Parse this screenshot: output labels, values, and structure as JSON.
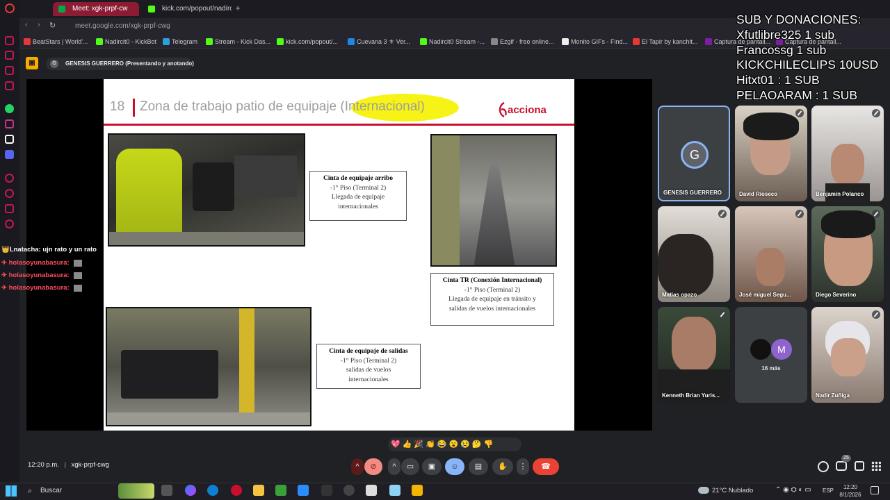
{
  "browser": {
    "tabs": [
      {
        "label": "Meet: xgk-prpf-cw",
        "active": true
      },
      {
        "label": "kick.com/popout/nadircl/c",
        "active": false
      }
    ],
    "url": "meet.google.com/xgk-prpf-cwg",
    "bookmarks": [
      {
        "label": "BeatStars | World'...",
        "color": "#e53935"
      },
      {
        "label": "Nadircit0 - KickBot",
        "color": "#53fc18"
      },
      {
        "label": "Telegram",
        "color": "#2aa1da"
      },
      {
        "label": "Stream - Kick Das...",
        "color": "#53fc18"
      },
      {
        "label": "kick.com/popout/...",
        "color": "#53fc18"
      },
      {
        "label": "Cuevana 3 ⚜ Ver...",
        "color": "#1e88e5"
      },
      {
        "label": "Nadircit0 Stream -...",
        "color": "#53fc18"
      },
      {
        "label": "Ezgif - free online...",
        "color": "#888888"
      },
      {
        "label": "Monito GIFs - Find...",
        "color": "#eeeeee"
      },
      {
        "label": "El Tapir by kanchit...",
        "color": "#e53935"
      },
      {
        "label": "Captura de pantall...",
        "color": "#7b1fa2"
      },
      {
        "label": "Captura de pantall...",
        "color": "#7b1fa2"
      }
    ]
  },
  "meet": {
    "presenter_label": "GENESIS GUERRERO (Presentando y anotando)",
    "presenter_initial": "G",
    "meeting_time": "12:20 p.m.",
    "meeting_code": "xgk-prpf-cwg",
    "reactions": [
      "💖",
      "👍",
      "🎉",
      "👏",
      "😂",
      "😮",
      "😢",
      "🤔",
      "👎"
    ],
    "participants_badge": "25",
    "participants": [
      {
        "name": "GENESIS GUERRERO",
        "initial": "G"
      },
      {
        "name": "David Rioseco"
      },
      {
        "name": "Benjamin Polanco"
      },
      {
        "name": "Matias opazo"
      },
      {
        "name": "José miguel Segu..."
      },
      {
        "name": "Diego Severino"
      },
      {
        "name": "Kenneth Brian Yuris..."
      },
      {
        "name": "16 más",
        "initial": "M"
      },
      {
        "name": "Nadir Zuñiga"
      }
    ]
  },
  "slide": {
    "number": "18",
    "title_main": "Zona de trabajo patio de equipaje ",
    "title_highlight": "(Internacional)",
    "logo": "acciona",
    "callouts": [
      {
        "title": "Cinta de equipaje arribo",
        "lines": [
          "-1° Piso (Terminal 2)",
          "Llegada de equipaje",
          "internacionales"
        ]
      },
      {
        "title": "Cinta TR (Conexión Internacional)",
        "lines": [
          "-1° Piso (Terminal 2)",
          "Llegada de equipaje en tránsito y",
          "salidas de vuelos internacionales"
        ]
      },
      {
        "title": "Cinta de equipaje de salidas",
        "lines": [
          "-1° Piso (Terminal 2)",
          "salidas de vuelos",
          "internacionales"
        ]
      }
    ]
  },
  "overlay": {
    "donations": [
      "SUB Y DONACIONES:",
      "Xfutlibre325 1 sub",
      "Francossg 1 sub",
      "KICKCHILECLIPS 10USD",
      "Hitxt01 : 1 SUB",
      "PELAOARAM : 1 SUB"
    ],
    "chat": [
      {
        "user": "👑Lnatacha:",
        "message": "ujn rato y un rato",
        "color": "#ffffff"
      },
      {
        "user": "✈ holasoyunabasura:",
        "message": "",
        "color": "#ff4d5e"
      },
      {
        "user": "✈ holasoyunabasura:",
        "message": "",
        "color": "#ff4d5e"
      },
      {
        "user": "✈ holasoyunabasura:",
        "message": "",
        "color": "#ff4d5e"
      }
    ]
  },
  "taskbar": {
    "search": "Buscar",
    "weather": "21°C  Nublado",
    "language": "ESP",
    "time": "12:20",
    "date": "8/1/2026"
  }
}
